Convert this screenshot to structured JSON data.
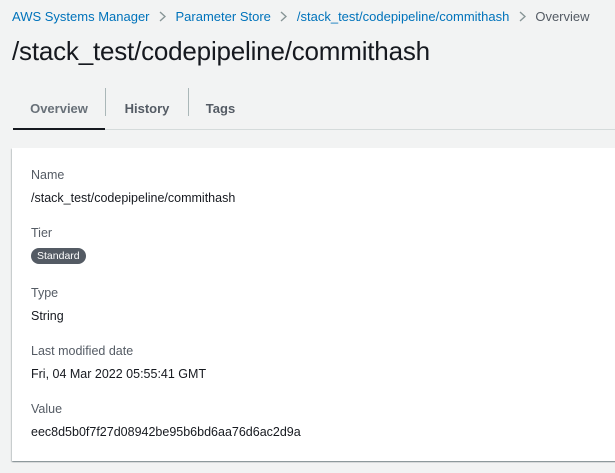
{
  "breadcrumb": {
    "items": [
      {
        "label": "AWS Systems Manager"
      },
      {
        "label": "Parameter Store"
      },
      {
        "label": "/stack_test/codepipeline/commithash"
      },
      {
        "label": "Overview"
      }
    ]
  },
  "page": {
    "title": "/stack_test/codepipeline/commithash"
  },
  "tabs": [
    {
      "label": "Overview",
      "active": true
    },
    {
      "label": "History",
      "active": false
    },
    {
      "label": "Tags",
      "active": false
    }
  ],
  "details": {
    "name": {
      "label": "Name",
      "value": "/stack_test/codepipeline/commithash"
    },
    "tier": {
      "label": "Tier",
      "value": "Standard"
    },
    "type": {
      "label": "Type",
      "value": "String"
    },
    "last_modified": {
      "label": "Last modified date",
      "value": "Fri, 04 Mar 2022 05:55:41 GMT"
    },
    "value": {
      "label": "Value",
      "value": "eec8d5b0f7f27d08942be95b6bd6aa76d6ac2d9a"
    }
  },
  "colors": {
    "link": "#0073bb",
    "background": "#f2f3f3",
    "badge": "#545b64"
  }
}
